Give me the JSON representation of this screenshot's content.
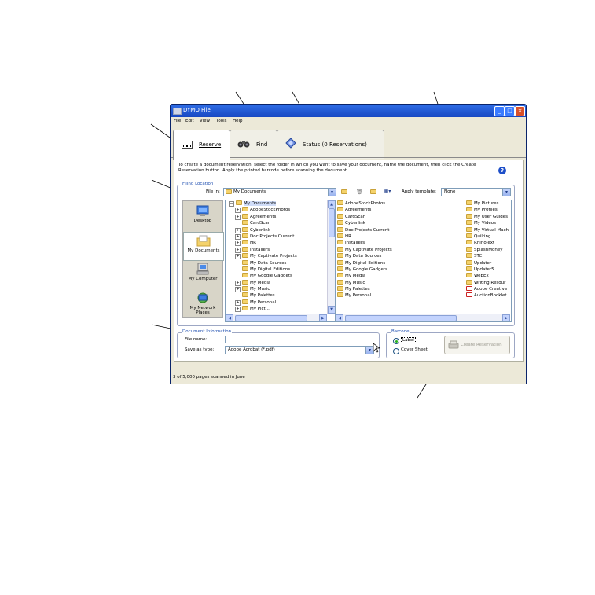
{
  "window": {
    "title": "DYMO File"
  },
  "menu": [
    "File",
    "Edit",
    "View",
    "Tools",
    "Help"
  ],
  "tabs": [
    {
      "label": "Reserve",
      "icon": "barcode-label-icon"
    },
    {
      "label": "Find",
      "icon": "binoculars-icon"
    },
    {
      "label": "Status (0 Reservations)",
      "icon": "status-diamond-icon"
    }
  ],
  "instructions": "To create a document reservation: select the folder in which you want to save your document, name the document, then click the Create Reservation button.  Apply the printed barcode before scanning the document.",
  "filing": {
    "group_label": "Filing Location",
    "file_in_label": "File in:",
    "file_in_value": "My Documents",
    "apply_template_label": "Apply template:",
    "template_value": "None"
  },
  "places": [
    "Desktop",
    "My Documents",
    "My Computer",
    "My Network Places"
  ],
  "tree": {
    "root": "My Documents",
    "items": [
      "AdobeStockPhotos",
      "Agreements",
      "CardScan",
      "Cyberlink",
      "Doc Projects Current",
      "HR",
      "Installers",
      "My Captivate Projects",
      "My Data Sources",
      "My Digital Editions",
      "My Google Gadgets",
      "My Media",
      "My Music",
      "My Palettes",
      "My Personal",
      "My Pict..."
    ]
  },
  "files_col1": [
    "AdobeStockPhotos",
    "Agreements",
    "CardScan",
    "Cyberlink",
    "Doc Projects Current",
    "HR",
    "Installers",
    "My Captivate Projects",
    "My Data Sources",
    "My Digital Editions",
    "My Google Gadgets",
    "My Media",
    "My Music",
    "My Palettes",
    "My Personal"
  ],
  "files_col2": [
    "My Pictures",
    "My Profiles",
    "My User Guides",
    "My Videos",
    "My Virtual Mach",
    "Quilting",
    "Rhino ext",
    "SplashMoney",
    "STC",
    "Updater",
    "Updater5",
    "WebEx",
    "Writing Resour",
    "Adobe Creative",
    "AuctionBooklet"
  ],
  "doc_info": {
    "group_label": "Document Information",
    "file_name_label": "File name:",
    "file_name_value": "",
    "save_as_label": "Save as type:",
    "save_as_value": "Adobe Acrobat (*.pdf)"
  },
  "barcode": {
    "group_label": "Barcode",
    "option_label": "Label",
    "option_cover": "Cover Sheet",
    "selected": "Label"
  },
  "create_button": "Create Reservation",
  "status_text": "3 of 5,000 pages scanned in June"
}
